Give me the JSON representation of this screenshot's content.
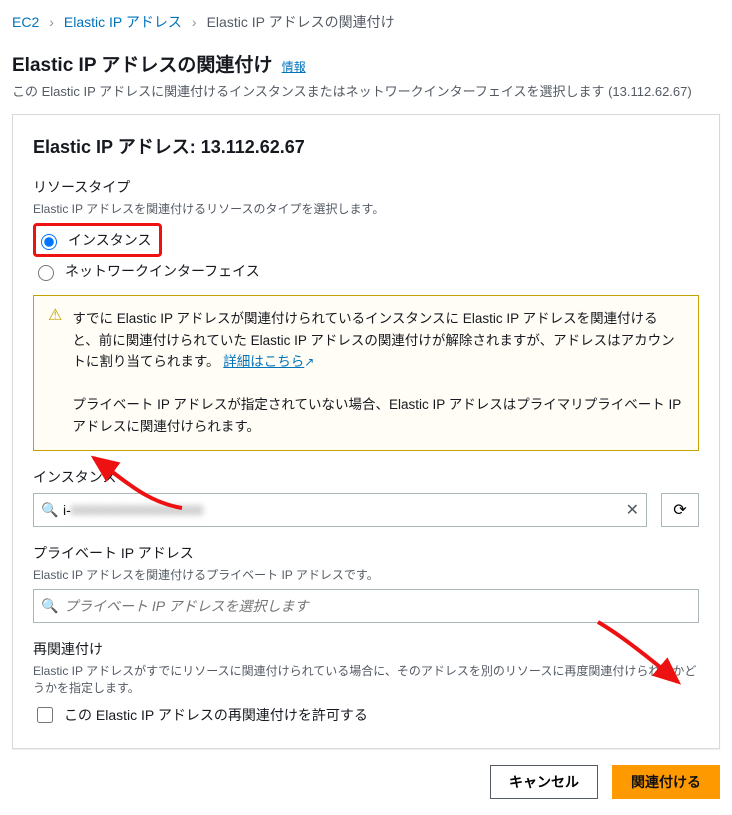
{
  "breadcrumb": {
    "a": "EC2",
    "b": "Elastic IP アドレス",
    "c": "Elastic IP アドレスの関連付け"
  },
  "header": {
    "title": "Elastic IP アドレスの関連付け",
    "info": "情報",
    "desc": "この Elastic IP アドレスに関連付けるインスタンスまたはネットワークインターフェイスを選択します (13.112.62.67)"
  },
  "panel": {
    "title": "Elastic IP アドレス: 13.112.62.67"
  },
  "resourceType": {
    "label": "リソースタイプ",
    "hint": "Elastic IP アドレスを関連付けるリソースのタイプを選択します。",
    "opt1": "インスタンス",
    "opt2": "ネットワークインターフェイス"
  },
  "alert": {
    "p1": "すでに Elastic IP アドレスが関連付けられているインスタンスに Elastic IP アドレスを関連付けると、前に関連付けられていた Elastic IP アドレスの関連付けが解除されますが、アドレスはアカウントに割り当てられます。",
    "link": "詳細はこちら",
    "p2": "プライベート IP アドレスが指定されていない場合、Elastic IP アドレスはプライマリプライベート IP アドレスに関連付けられます。"
  },
  "instance": {
    "label": "インスタンス",
    "value": "i-00000000000000000"
  },
  "privateIp": {
    "label": "プライベート IP アドレス",
    "hint": "Elastic IP アドレスを関連付けるプライベート IP アドレスです。",
    "placeholder": "プライベート IP アドレスを選択します"
  },
  "reassoc": {
    "label": "再関連付け",
    "hint": "Elastic IP アドレスがすでにリソースに関連付けられている場合に、そのアドレスを別のリソースに再度関連付けられるかどうかを指定します。",
    "chk": "この Elastic IP アドレスの再関連付けを許可する"
  },
  "actions": {
    "cancel": "キャンセル",
    "submit": "関連付ける"
  }
}
